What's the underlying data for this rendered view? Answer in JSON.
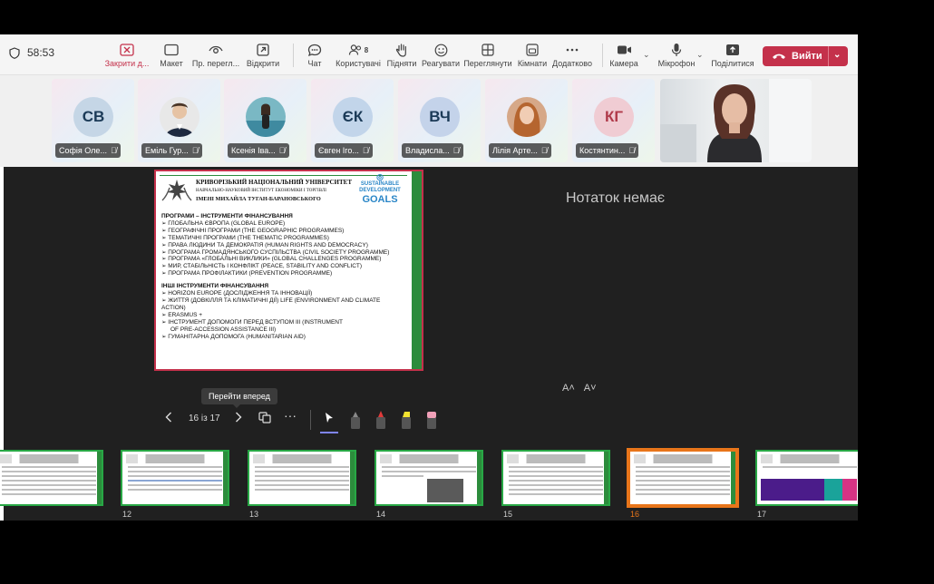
{
  "meeting": {
    "timer": "58:53",
    "toolbar": [
      {
        "key": "close",
        "label": "Закрити д...",
        "icon": "close-box-icon"
      },
      {
        "key": "layout",
        "label": "Макет",
        "icon": "layout-icon"
      },
      {
        "key": "view",
        "label": "Пр. перегл...",
        "icon": "eye-icon"
      },
      {
        "key": "open",
        "label": "Відкрити",
        "icon": "open-external-icon"
      },
      {
        "key": "chat",
        "label": "Чат",
        "icon": "chat-icon"
      },
      {
        "key": "people",
        "label": "Користувачі",
        "icon": "people-icon",
        "count": "8"
      },
      {
        "key": "raise",
        "label": "Підняти",
        "icon": "raise-hand-icon"
      },
      {
        "key": "react",
        "label": "Реагувати",
        "icon": "smile-icon"
      },
      {
        "key": "view2",
        "label": "Переглянути",
        "icon": "grid-view-icon"
      },
      {
        "key": "rooms",
        "label": "Кімнати",
        "icon": "rooms-icon"
      },
      {
        "key": "more",
        "label": "Додатково",
        "icon": "more-icon"
      },
      {
        "key": "camera",
        "label": "Камера",
        "icon": "camera-icon"
      },
      {
        "key": "mic",
        "label": "Мікрофон",
        "icon": "microphone-icon"
      },
      {
        "key": "share",
        "label": "Поділитися",
        "icon": "share-icon"
      }
    ],
    "leave_label": "Вийти"
  },
  "participants": [
    {
      "initials": "СВ",
      "name": "Софія Оле...",
      "color": "#1b3a57",
      "bg": "#c5d6e6"
    },
    {
      "initials": "",
      "name": "Еміль Гур...",
      "photo": true
    },
    {
      "initials": "",
      "name": "Ксенія Іва...",
      "photo": true
    },
    {
      "initials": "ЄК",
      "name": "Євген Іго...",
      "color": "#1b3a57",
      "bg": "#c2d5ea"
    },
    {
      "initials": "ВЧ",
      "name": "Владисла...",
      "color": "#1b3a57",
      "bg": "#c4d3ea"
    },
    {
      "initials": "",
      "name": "Лілія Арте...",
      "photo": true
    },
    {
      "initials": "КГ",
      "name": "Костянтин...",
      "color": "#b03a4a",
      "bg": "#f0ccd3"
    }
  ],
  "slide": {
    "university_line1": "КРИВОРІЗЬКИЙ НАЦІОНАЛЬНИЙ УНІВЕРСИТЕТ",
    "university_line2": "НАВЧАЛЬНО-НАУКОВИЙ ІНСТИТУТ ЕКОНОМІКИ І ТОРГІВЛІ",
    "university_line3": "ІМЕНІ МИХАЙЛА ТУГАН-БАРАНОВСЬКОГО",
    "sdg_line1": "SUSTAINABLE",
    "sdg_line2": "DEVELOPMENT",
    "sdg_line3": "GOALS",
    "heading1": "ПРОГРАМИ – ІНСТРУМЕНТИ ФІНАНСУВАННЯ",
    "items1": [
      "ГЛОБАЛЬНА ЄВРОПА (GLOBAL EUROPE)",
      "ГЕОГРАФІЧНІ ПРОГРАМИ (THE GEOGRAPHIC PROGRAMMES)",
      "ТЕМАТИЧНІ ПРОГРАМИ (THE THEMATIC PROGRAMMES)",
      "ПРАВА ЛЮДИНИ ТА ДЕМОКРАТІЯ (HUMAN RIGHTS AND DEMOCRACY)",
      "ПРОГРАМА ГРОМАДЯНСЬКОГО СУСПІЛЬСТВА (CIVIL SOCIETY PROGRAMME)",
      "ПРОГРАМА «ГЛОБАЛЬНІ ВИКЛИКИ» (GLOBAL CHALLENGES PROGRAMME)",
      "МИР, СТАБІЛЬНІСТЬ І КОНФЛІКТ (PEACE, STABILITY AND CONFLICT)",
      "ПРОГРАМА ПРОФІЛАКТИКИ (PREVENTION PROGRAMME)"
    ],
    "heading2": "ІНШІ ІНСТРУМЕНТИ ФІНАНСУВАННЯ",
    "items2": [
      "HORIZON EUROPE (ДОСЛІДЖЕННЯ ТА ІННОВАЦІЇ)",
      "ЖИТТЯ (ДОВКІЛЛЯ ТА КЛІМАТИЧНІ ДІЇ) LIFE (ENVIRONMENT AND CLIMATE ACTION)",
      "ERASMUS +",
      "ІНСТРУМЕНТ ДОПОМОГИ ПЕРЕД ВСТУПОМ III (INSTRUMENT",
      "OF PRE-ACCESSION ASSISTANCE III)",
      "ГУМАНІТАРНА ДОПОМОГА (HUMANITARIAN AID)"
    ]
  },
  "presenter": {
    "notes_empty": "Нотаток немає",
    "font_up": "A˄",
    "font_down": "A˅",
    "tooltip": "Перейти вперед",
    "page": "16 із 17"
  },
  "thumbnails": [
    {
      "num": ""
    },
    {
      "num": "12"
    },
    {
      "num": "13"
    },
    {
      "num": "14"
    },
    {
      "num": "15"
    },
    {
      "num": "16",
      "active": true
    },
    {
      "num": "17"
    }
  ],
  "colors": {
    "accent": "#c4314b",
    "active_thumb": "#e8751a",
    "thumb_border": "#28a745"
  }
}
